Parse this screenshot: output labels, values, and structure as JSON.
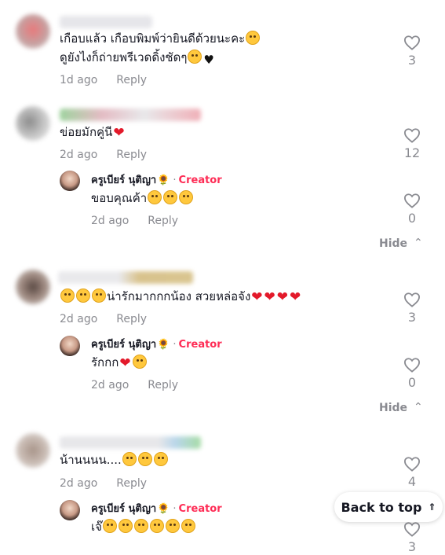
{
  "comments": [
    {
      "line1": "เกือบแล้ว เกือบพิมพ์ว่ายินดีด้วยนะคะ",
      "line2": "ดูยังไงก็ถ่ายพรีเวดดิ้งชัดๆ",
      "time": "1d ago",
      "reply": "Reply",
      "likes": "3"
    },
    {
      "line1": "ข่อยมักคู่นี",
      "time": "2d ago",
      "reply": "Reply",
      "likes": "12",
      "creator_reply": {
        "name": "ครูเบียร์ นุติญา",
        "dot": "·",
        "tag": "Creator",
        "text": "ขอบคุณค้า",
        "time": "2d ago",
        "reply": "Reply",
        "likes": "0"
      },
      "hide": "Hide"
    },
    {
      "line1": "น่ารักมากกกน้อง สวยหล่อจัง",
      "time": "2d ago",
      "reply": "Reply",
      "likes": "3",
      "creator_reply": {
        "name": "ครูเบียร์ นุติญา",
        "dot": "·",
        "tag": "Creator",
        "text": "รักกก",
        "time": "2d ago",
        "reply": "Reply",
        "likes": "0"
      },
      "hide": "Hide"
    },
    {
      "line1": "น้านนนน....",
      "time": "2d ago",
      "reply": "Reply",
      "likes": "4",
      "creator_reply": {
        "name": "ครูเบียร์ นุติญา",
        "dot": "·",
        "tag": "Creator",
        "text": "เจ๊",
        "likes": "3"
      }
    }
  ],
  "back_to_top": "Back to top",
  "icons": {
    "like": "heart-outline-icon",
    "hide_chevron": "chevron-up-icon",
    "back_to_top": "double-chevron-up-icon"
  },
  "colors": {
    "creator_tag": "#fe2c55",
    "muted": "#8a8b91",
    "text": "#161823"
  }
}
